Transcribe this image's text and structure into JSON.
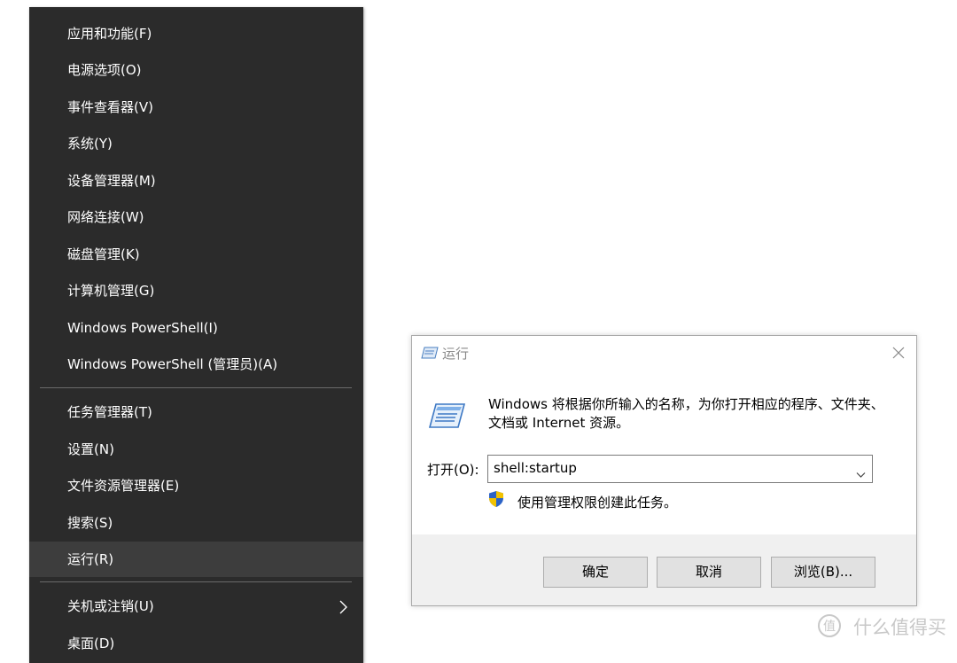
{
  "winx_menu": {
    "items": [
      {
        "label": "应用和功能(F)"
      },
      {
        "label": "电源选项(O)"
      },
      {
        "label": "事件查看器(V)"
      },
      {
        "label": "系统(Y)"
      },
      {
        "label": "设备管理器(M)"
      },
      {
        "label": "网络连接(W)"
      },
      {
        "label": "磁盘管理(K)"
      },
      {
        "label": "计算机管理(G)"
      },
      {
        "label": "Windows PowerShell(I)"
      },
      {
        "label": "Windows PowerShell (管理员)(A)"
      },
      {
        "label": "任务管理器(T)"
      },
      {
        "label": "设置(N)"
      },
      {
        "label": "文件资源管理器(E)"
      },
      {
        "label": "搜索(S)"
      },
      {
        "label": "运行(R)",
        "active": true
      },
      {
        "label": "关机或注销(U)",
        "submenu": true
      },
      {
        "label": "桌面(D)"
      }
    ]
  },
  "run_dialog": {
    "title": "运行",
    "description": "Windows 将根据你所输入的名称，为你打开相应的程序、文件夹、文档或 Internet 资源。",
    "open_label": "打开(O):",
    "open_value": "shell:startup",
    "admin_text": "使用管理权限创建此任务。",
    "buttons": {
      "ok": "确定",
      "cancel": "取消",
      "browse": "浏览(B)..."
    }
  },
  "watermark": {
    "text": "什么值得买"
  },
  "colors": {
    "menu_bg": "#2b2b2b",
    "menu_active": "#3d3d3d",
    "dialog_footer": "#f0f0f0",
    "button_bg": "#e1e1e1"
  }
}
